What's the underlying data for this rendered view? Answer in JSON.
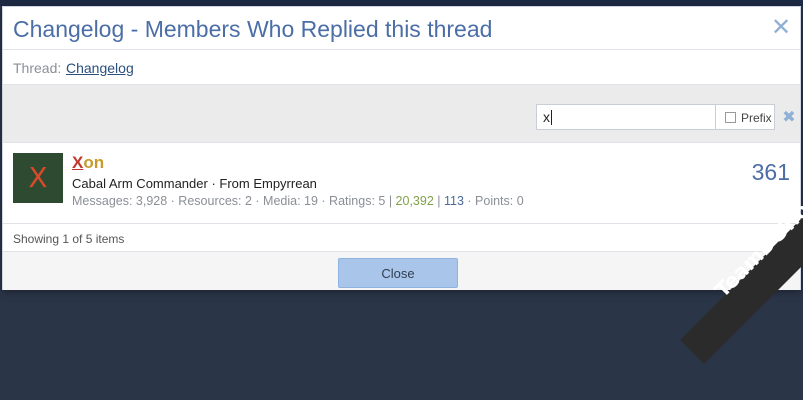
{
  "dialog": {
    "title": "Changelog - Members Who Replied this thread",
    "close_icon": "close-icon",
    "thread_label": "Thread:",
    "thread_link": "Changelog",
    "filter": {
      "value": "x",
      "prefix_label": "Prefix",
      "prefix_checked": false
    },
    "members": [
      {
        "avatar_letter": "X",
        "username_first": "X",
        "username_rest": "on",
        "title_line": "Cabal Arm Commander · From Empyrrean",
        "stats_prefix": "Messages: 3,928 · Resources: 2 · Media: 19 · Ratings: 5 | ",
        "stats_green": "20,392",
        "stats_sep": " | ",
        "stats_blue": "113",
        "stats_suffix": " · Points: 0",
        "reply_count": "361"
      }
    ],
    "showing": "Showing 1 of 5 items",
    "close_button": "Close"
  },
  "watermark": "TeamDGT.org",
  "colors": {
    "title": "#4b6ea6",
    "close_button_bg": "#a9c6ea",
    "avatar_bg": "#2e4a30",
    "username": "#c79a2d"
  }
}
